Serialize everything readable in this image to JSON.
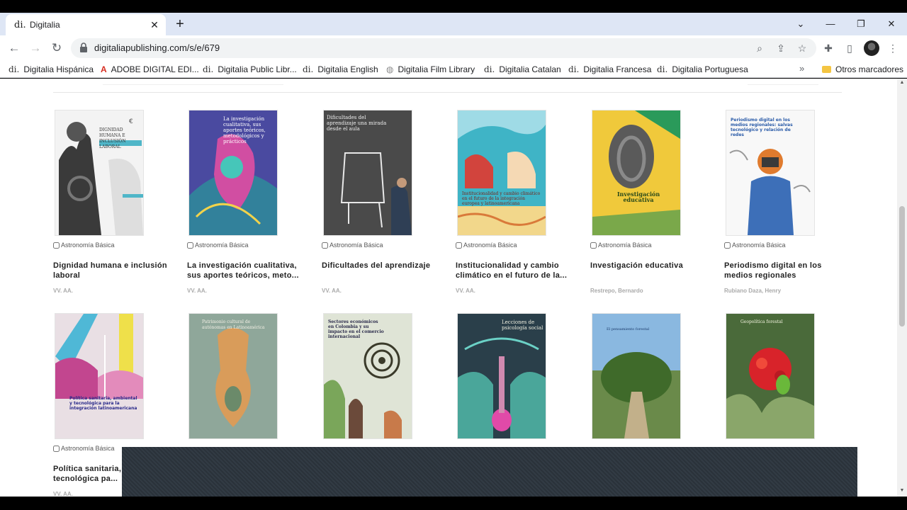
{
  "tab": {
    "favicon": "di.",
    "title": "Digitalia",
    "close": "✕"
  },
  "new_tab": "+",
  "window_controls": {
    "dropdown": "⌄",
    "minimize": "—",
    "restore": "❐",
    "close": "✕"
  },
  "nav": {
    "back": "←",
    "forward": "→",
    "reload": "↻"
  },
  "address_bar": {
    "url": "digitaliapublishing.com/s/e/679"
  },
  "bookmarks": [
    {
      "icon": "di.",
      "label": "Digitalia Hispánica"
    },
    {
      "icon": "A",
      "label": "ADOBE DIGITAL EDI..."
    },
    {
      "icon": "di.",
      "label": "Digitalia Public Libr..."
    },
    {
      "icon": "di.",
      "label": "Digitalia English"
    },
    {
      "icon": "◍",
      "label": "Digitalia Film Library"
    },
    {
      "icon": "di.",
      "label": "Digitalia Catalan"
    },
    {
      "icon": "di.",
      "label": "Digitalia Francesa"
    },
    {
      "icon": "di.",
      "label": "Digitalia Portuguesa"
    }
  ],
  "bookmarks_more": "»",
  "other_bookmarks": "Otros marcadores",
  "books_row1": [
    {
      "category": "Astronomía Básica",
      "title": "Dignidad humana e inclusión laboral",
      "author": "VV. AA.",
      "cover_text": "DIGNIDAD HUMANA E INCLUSIÓN LABORAL"
    },
    {
      "category": "Astronomía Básica",
      "title": "La investigación cualitativa, sus aportes teóricos, meto...",
      "author": "VV. AA.",
      "cover_text": "La investigación cualitativa, sus aportes teóricos, metodológicos y prácticos"
    },
    {
      "category": "Astronomía Básica",
      "title": "Dificultades del aprendizaje",
      "author": "VV. AA.",
      "cover_text": "Dificultades del aprendizaje una mirada desde el aula"
    },
    {
      "category": "Astronomía Básica",
      "title": "Institucionalidad y cambio climático en el futuro de la...",
      "author": "VV. AA.",
      "cover_text": "Institucionalidad y cambio climático en el futuro de la integración europea y latinoamericana"
    },
    {
      "category": "Astronomía Básica",
      "title": "Investigación educativa",
      "author": "Restrepo, Bernardo",
      "cover_text": "Investigación educativa"
    },
    {
      "category": "Astronomía Básica",
      "title": "Periodismo digital en los medios regionales",
      "author": "Rubiano Daza, Henry",
      "cover_text": "Periodismo digital en los medios regionales: salvas tecnológico y relación de redes"
    }
  ],
  "books_row2": [
    {
      "category": "Astronomía Básica",
      "title": "Política sanitaria, ambiental y tecnológica pa...",
      "author": "VV. AA.",
      "cover_text": "Política sanitaria, ambiental y tecnológica para la integración latinoamericana"
    },
    {
      "cover_text": "Patrimonio cultural de autónomas en Latinoamérica"
    },
    {
      "cover_text": "Sectores económicos en Colombia y su impacto en el comercio internacional"
    },
    {
      "cover_text": "Lecciones de psicología social"
    },
    {
      "cover_text": "El pensamiento forestal"
    },
    {
      "cover_text": "Geopolítica forestal"
    }
  ],
  "colors": {
    "tab_strip": "#dee6f5",
    "overlay": "#2c343c",
    "author_gray": "#aaaaaa"
  }
}
